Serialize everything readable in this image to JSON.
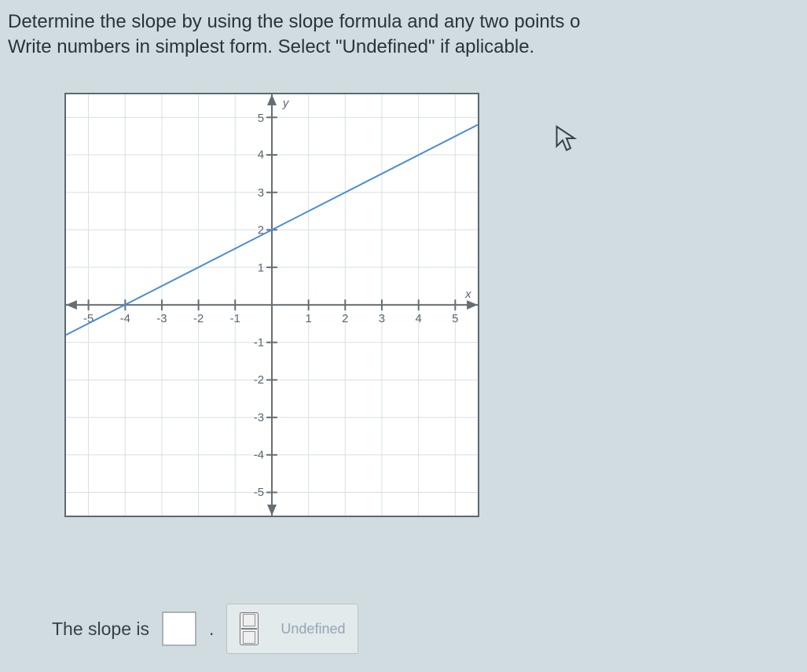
{
  "question": {
    "line1": "Determine the slope by using the slope formula and any two points o",
    "line2": "Write numbers in simplest form. Select \"Undefined\" if aplicable."
  },
  "chart_data": {
    "type": "line",
    "xlabel": "x",
    "ylabel": "y",
    "xlim": [
      -5.6,
      5.6
    ],
    "ylim": [
      -5.6,
      5.6
    ],
    "xticks": [
      -5,
      -4,
      -3,
      -2,
      -1,
      1,
      2,
      3,
      4,
      5
    ],
    "yticks": [
      -5,
      -4,
      -3,
      -2,
      -1,
      1,
      2,
      3,
      4,
      5
    ],
    "series": [
      {
        "name": "line",
        "x": [
          -5.6,
          5.6
        ],
        "y": [
          -0.73,
          4.87
        ]
      }
    ],
    "info": "line approx y = 0.5x + 2, passes near (-4,0) and (0,2)"
  },
  "answer": {
    "prompt": "The slope is",
    "value": "",
    "period": "."
  },
  "helpers": {
    "undefined_label": "Undefined"
  }
}
